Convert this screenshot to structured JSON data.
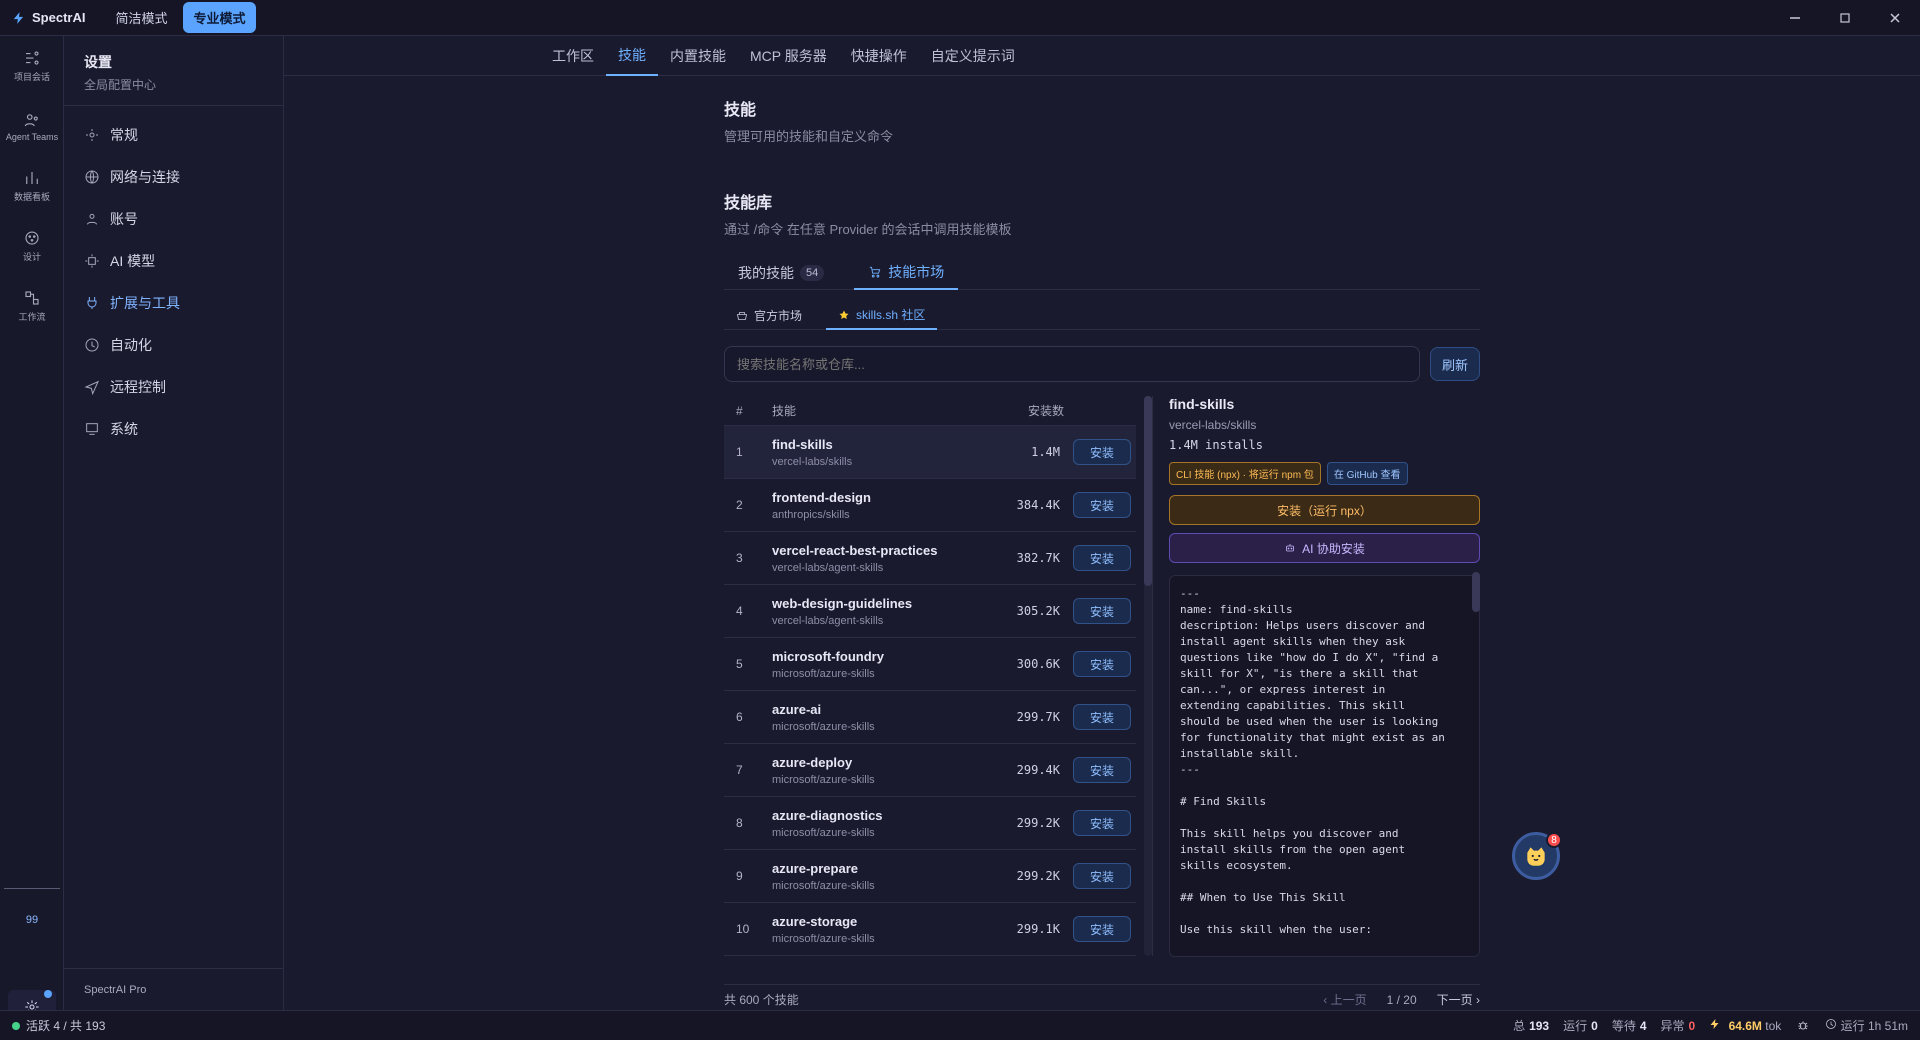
{
  "app": {
    "title": "SpectrAI",
    "modes": [
      "简洁模式",
      "专业模式"
    ],
    "active_mode": "专业模式",
    "window_controls": [
      "minimize",
      "maximize",
      "close"
    ]
  },
  "icon_rail": {
    "items": [
      {
        "icon": "project-sessions-icon",
        "label": "项目会话"
      },
      {
        "icon": "agent-teams-icon",
        "label": "Agent Teams"
      },
      {
        "icon": "dashboard-icon",
        "label": "数据看板"
      },
      {
        "icon": "design-icon",
        "label": "设计"
      },
      {
        "icon": "workflow-icon",
        "label": "工作流"
      }
    ],
    "bottom_count": "99",
    "settings_label": "设置"
  },
  "settings": {
    "title": "设置",
    "subtitle": "全局配置中心",
    "items": [
      {
        "icon": "gear-icon",
        "label": "常规"
      },
      {
        "icon": "globe-icon",
        "label": "网络与连接"
      },
      {
        "icon": "user-icon",
        "label": "账号"
      },
      {
        "icon": "chip-icon",
        "label": "AI 模型"
      },
      {
        "icon": "plug-icon",
        "label": "扩展与工具"
      },
      {
        "icon": "clock-icon",
        "label": "自动化"
      },
      {
        "icon": "send-icon",
        "label": "远程控制"
      },
      {
        "icon": "system-icon",
        "label": "系统"
      }
    ],
    "active": "扩展与工具",
    "footer": "SpectrAI Pro"
  },
  "top_tabs": {
    "items": [
      "工作区",
      "技能",
      "内置技能",
      "MCP 服务器",
      "快捷操作",
      "自定义提示词"
    ],
    "active": "技能"
  },
  "page": {
    "title": "技能",
    "subtitle": "管理可用的技能和自定义命令",
    "library_title": "技能库",
    "library_subtitle": "通过 /命令 在任意 Provider 的会话中调用技能模板",
    "tabs": [
      {
        "label": "我的技能",
        "count": "54"
      },
      {
        "label": "技能市场"
      }
    ],
    "active_tab": "技能市场",
    "subtabs": [
      "官方市场",
      "skills.sh 社区"
    ],
    "active_subtab": "skills.sh 社区",
    "search": {
      "placeholder": "搜索技能名称或仓库...",
      "value": ""
    },
    "refresh_label": "刷新"
  },
  "table": {
    "headers": [
      "#",
      "技能",
      "安装数",
      ""
    ],
    "install_label": "安装",
    "rows": [
      {
        "n": "1",
        "name": "find-skills",
        "repo": "vercel-labs/skills",
        "installs": "1.4M"
      },
      {
        "n": "2",
        "name": "frontend-design",
        "repo": "anthropics/skills",
        "installs": "384.4K"
      },
      {
        "n": "3",
        "name": "vercel-react-best-practices",
        "repo": "vercel-labs/agent-skills",
        "installs": "382.7K"
      },
      {
        "n": "4",
        "name": "web-design-guidelines",
        "repo": "vercel-labs/agent-skills",
        "installs": "305.2K"
      },
      {
        "n": "5",
        "name": "microsoft-foundry",
        "repo": "microsoft/azure-skills",
        "installs": "300.6K"
      },
      {
        "n": "6",
        "name": "azure-ai",
        "repo": "microsoft/azure-skills",
        "installs": "299.7K"
      },
      {
        "n": "7",
        "name": "azure-deploy",
        "repo": "microsoft/azure-skills",
        "installs": "299.4K"
      },
      {
        "n": "8",
        "name": "azure-diagnostics",
        "repo": "microsoft/azure-skills",
        "installs": "299.2K"
      },
      {
        "n": "9",
        "name": "azure-prepare",
        "repo": "microsoft/azure-skills",
        "installs": "299.2K"
      },
      {
        "n": "10",
        "name": "azure-storage",
        "repo": "microsoft/azure-skills",
        "installs": "299.1K"
      }
    ],
    "selected_index": 0
  },
  "detail": {
    "name": "find-skills",
    "repo": "vercel-labs/skills",
    "installs": "1.4M installs",
    "badges": [
      {
        "type": "warn",
        "label": "CLI 技能 (npx) · 将运行 npm 包"
      },
      {
        "type": "link",
        "label": "在 GitHub 查看"
      }
    ],
    "install_btn": "安装（运行 npx）",
    "ai_btn": "AI 协助安装",
    "readme": "---\nname: find-skills\ndescription: Helps users discover and\ninstall agent skills when they ask\nquestions like \"how do I do X\", \"find a\nskill for X\", \"is there a skill that\ncan...\", or express interest in\nextending capabilities. This skill\nshould be used when the user is looking\nfor functionality that might exist as an\ninstallable skill.\n---\n\n# Find Skills\n\nThis skill helps you discover and\ninstall skills from the open agent\nskills ecosystem.\n\n## When to Use This Skill\n\nUse this skill when the user:\n\n- Asks \"how do I do X\" where X might be"
  },
  "pager": {
    "total": "共 600 个技能",
    "prev": "‹ 上一页",
    "page": "1 / 20",
    "next": "下一页 ›"
  },
  "helper": {
    "badge": "8",
    "icon": "cat-icon"
  },
  "status": {
    "active": "活跃 4 / 共 193",
    "metrics": [
      {
        "label": "总",
        "value": "193"
      },
      {
        "label": "运行",
        "value": "0"
      },
      {
        "label": "等待",
        "value": "4"
      },
      {
        "label": "异常",
        "value": "0"
      }
    ],
    "tokens": "64.6M",
    "tokens_unit": "tok",
    "uptime": "运行 1h 51m"
  },
  "colors": {
    "accent": "#5aa4ff",
    "warning": "#ffbb55",
    "danger": "#ff4d4d",
    "success": "#46d08a"
  }
}
